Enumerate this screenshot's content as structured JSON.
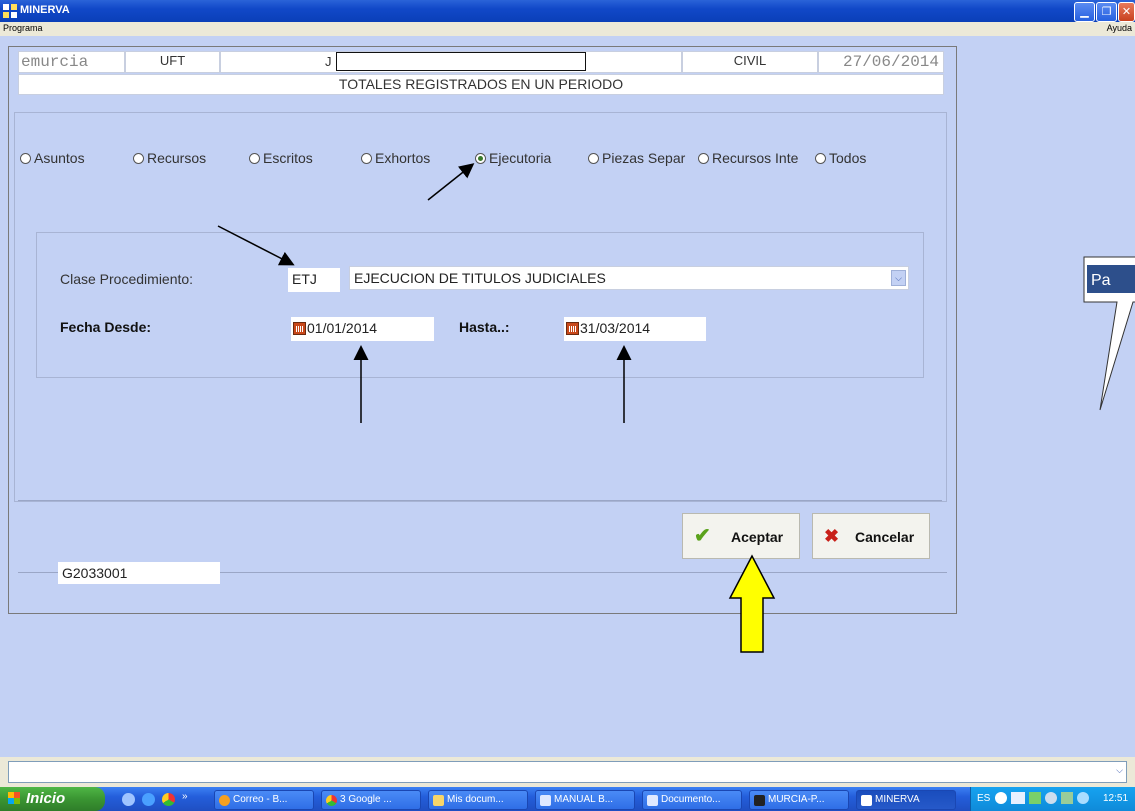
{
  "window": {
    "title": "MINERVA"
  },
  "menu": {
    "left": "Programa",
    "right": "Ayuda"
  },
  "header": {
    "user": "emurcia",
    "unit": "UFT",
    "code": "J",
    "jurisdiction": "CIVIL",
    "date": "27/06/2014",
    "subtitle": "TOTALES REGISTRADOS EN UN PERIODO"
  },
  "radios": [
    {
      "label": "Asuntos",
      "selected": false
    },
    {
      "label": "Recursos",
      "selected": false
    },
    {
      "label": "Escritos",
      "selected": false
    },
    {
      "label": "Exhortos",
      "selected": false
    },
    {
      "label": "Ejecutoria",
      "selected": true
    },
    {
      "label": "Piezas Separ",
      "selected": false
    },
    {
      "label": "Recursos Inte",
      "selected": false
    },
    {
      "label": "Todos",
      "selected": false
    }
  ],
  "filters": {
    "clase_label": "Clase Procedimiento:",
    "clase_code": "ETJ",
    "clase_desc": "EJECUCION DE TITULOS JUDICIALES",
    "desde_label": "Fecha Desde:",
    "desde_value": "01/01/2014",
    "hasta_label": "Hasta..:",
    "hasta_value": "31/03/2014"
  },
  "buttons": {
    "accept": "Aceptar",
    "cancel": "Cancelar"
  },
  "status_code": "G2033001",
  "callout": {
    "text": "Pa"
  },
  "taskbar": {
    "start": "Inicio",
    "tasks": [
      "Correo - B...",
      "3 Google ...",
      "Mis docum...",
      "MANUAL B...",
      "Documento...",
      "MURCIA-P...",
      "MINERVA"
    ],
    "lang": "ES",
    "clock": "12:51"
  },
  "colors": {
    "background": "#c3d1f4",
    "accept_check": "#5aa21b",
    "cancel_x": "#c8201a",
    "arrow_highlight": "#ffff00"
  }
}
